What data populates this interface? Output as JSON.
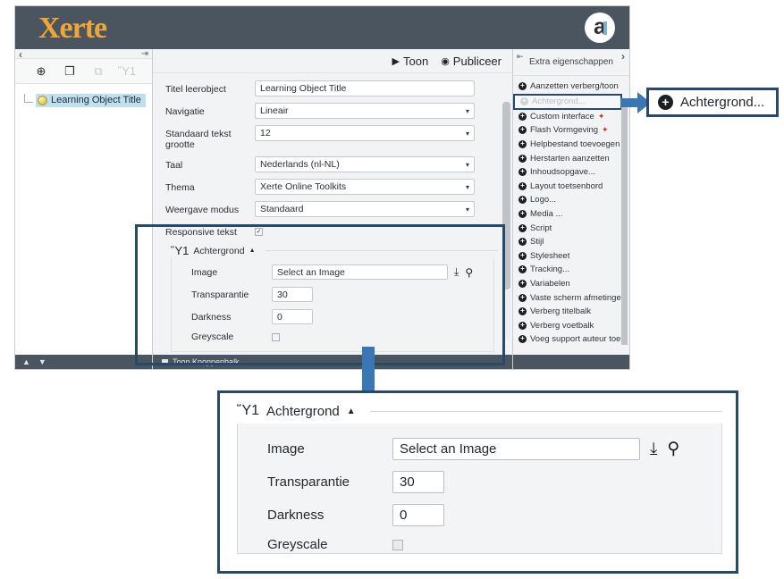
{
  "app": {
    "logo_text": "Xerte",
    "logo_mark": "a"
  },
  "left_pane": {
    "collapse_icon": "‹",
    "pin_icon": "⇥",
    "toolbar": [
      {
        "name": "add-page-button",
        "glyph": "⊕",
        "disabled": false
      },
      {
        "name": "duplicate-page-button",
        "glyph": "❐",
        "disabled": false
      },
      {
        "name": "copy-page-button",
        "glyph": "⧉",
        "disabled": true
      },
      {
        "name": "delete-page-button",
        "glyph": "Ὕ1",
        "disabled": true
      }
    ],
    "tree": [
      {
        "label": "Learning Object Title",
        "selected": true
      }
    ],
    "footer": {
      "up_icon": "▲",
      "down_icon": "▼"
    }
  },
  "center_pane": {
    "actions": [
      {
        "name": "preview-button",
        "glyph": "▶",
        "label": "Toon"
      },
      {
        "name": "publish-button",
        "glyph": "◉",
        "label": "Publiceer"
      }
    ],
    "fields": [
      {
        "label": "Titel leerobject",
        "value": "Learning Object Title",
        "type": "text"
      },
      {
        "label": "Navigatie",
        "value": "Lineair",
        "type": "select"
      },
      {
        "label": "Standaard tekst grootte",
        "value": "12",
        "type": "select"
      },
      {
        "label": "Taal",
        "value": "Nederlands (nl-NL)",
        "type": "select"
      },
      {
        "label": "Thema",
        "value": "Xerte Online Toolkits",
        "type": "select"
      },
      {
        "label": "Weergave modus",
        "value": "Standaard",
        "type": "select"
      },
      {
        "label": "Responsive tekst",
        "value": "✓",
        "type": "checkbox"
      }
    ],
    "background_section": {
      "trash_icon": "Ὕ1",
      "title": "Achtergrond",
      "collapse_glyph": "▲",
      "rows": [
        {
          "label": "Image",
          "value": "Select an Image",
          "type": "text-wide"
        },
        {
          "label": "Transparantie",
          "value": "30",
          "type": "text-small"
        },
        {
          "label": "Darkness",
          "value": "0",
          "type": "text-small"
        },
        {
          "label": "Greyscale",
          "value": "",
          "type": "checkbox"
        }
      ],
      "upload_icon": "⤓",
      "search_icon": "⚲"
    },
    "footer": {
      "checkbox": "",
      "label": "Toon Knoppenbalk"
    }
  },
  "right_pane": {
    "pin_icon": "⇤",
    "title": "Extra eigenschappen",
    "expand_icon": "›",
    "items": [
      {
        "label": "Aanzetten verberg/toon",
        "selected": false,
        "wand": false
      },
      {
        "label": "Achtergrond...",
        "selected": true,
        "wand": false
      },
      {
        "label": "Custom interface",
        "selected": false,
        "wand": true
      },
      {
        "label": "Flash Vormgeving",
        "selected": false,
        "wand": true
      },
      {
        "label": "Helpbestand toevoegen",
        "selected": false,
        "wand": false
      },
      {
        "label": "Herstarten aanzetten",
        "selected": false,
        "wand": false
      },
      {
        "label": "Inhoudsopgave...",
        "selected": false,
        "wand": false
      },
      {
        "label": "Layout toetsenbord",
        "selected": false,
        "wand": false
      },
      {
        "label": "Logo...",
        "selected": false,
        "wand": false
      },
      {
        "label": "Media ...",
        "selected": false,
        "wand": false
      },
      {
        "label": "Script",
        "selected": false,
        "wand": false
      },
      {
        "label": "Stijl",
        "selected": false,
        "wand": false
      },
      {
        "label": "Stylesheet",
        "selected": false,
        "wand": false
      },
      {
        "label": "Tracking...",
        "selected": false,
        "wand": false
      },
      {
        "label": "Variabelen",
        "selected": false,
        "wand": false
      },
      {
        "label": "Vaste scherm afmetingen",
        "selected": false,
        "wand": false
      },
      {
        "label": "Verberg titelbalk",
        "selected": false,
        "wand": false
      },
      {
        "label": "Verberg voetbalk",
        "selected": false,
        "wand": false
      },
      {
        "label": "Voeg support auteur toe",
        "selected": false,
        "wand": false
      }
    ]
  },
  "annotations": {
    "small_callout": {
      "plus_glyph": "✚",
      "label": "Achtergrond..."
    },
    "big_callout": {
      "trash_icon": "Ὕ1",
      "title": "Achtergrond",
      "collapse_glyph": "▲",
      "rows": [
        {
          "label": "Image",
          "value": "Select an Image",
          "type": "text-wide"
        },
        {
          "label": "Transparantie",
          "value": "30",
          "type": "text-small"
        },
        {
          "label": "Darkness",
          "value": "0",
          "type": "text-small"
        },
        {
          "label": "Greyscale",
          "value": "",
          "type": "checkbox"
        }
      ],
      "upload_icon": "⤓",
      "search_icon": "⚲"
    },
    "highlight_color": "#27496e",
    "arrow_color": "#3a78b5"
  }
}
